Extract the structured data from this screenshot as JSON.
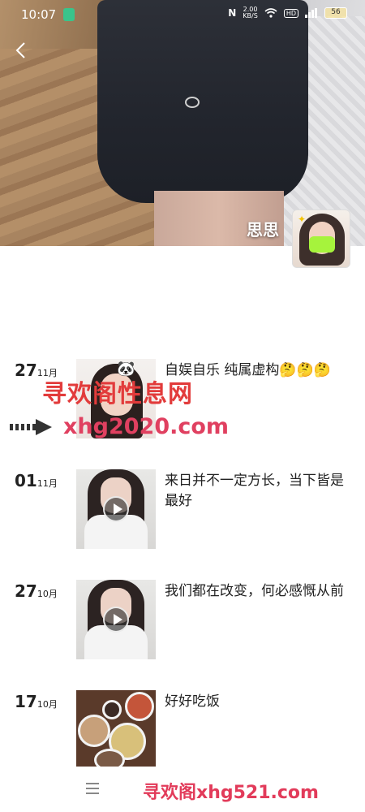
{
  "status_bar": {
    "time": "10:07",
    "net_speed_value": "2.00",
    "net_speed_unit": "KB/S",
    "hd_label": "HD",
    "battery": "56"
  },
  "profile": {
    "name": "思思"
  },
  "posts": [
    {
      "day": "27",
      "month": "11月",
      "text": "自娱自乐  纯属虚构🤔🤔🤔",
      "thumb": "photo",
      "has_play": false
    },
    {
      "day": "01",
      "month": "11月",
      "text": "来日并不一定方长，当下皆是最好",
      "thumb": "video",
      "has_play": true
    },
    {
      "day": "27",
      "month": "10月",
      "text": "我们都在改变，何必感慨从前",
      "thumb": "video",
      "has_play": true
    },
    {
      "day": "17",
      "month": "10月",
      "text": "好好吃饭",
      "thumb": "food",
      "has_play": false
    }
  ],
  "watermarks": {
    "title": "寻欢阁性息网",
    "url": "xhg2020.com",
    "bottom": "寻欢阁xhg521.com"
  },
  "icons": {
    "back": "chevron-left-icon",
    "play": "play-icon",
    "menu": "menu-icon",
    "shield": "shield-icon",
    "battery": "battery-icon"
  },
  "colors": {
    "watermark_red": "#e23b3b",
    "watermark_pink": "#e04060",
    "status_green": "#39c48b"
  }
}
